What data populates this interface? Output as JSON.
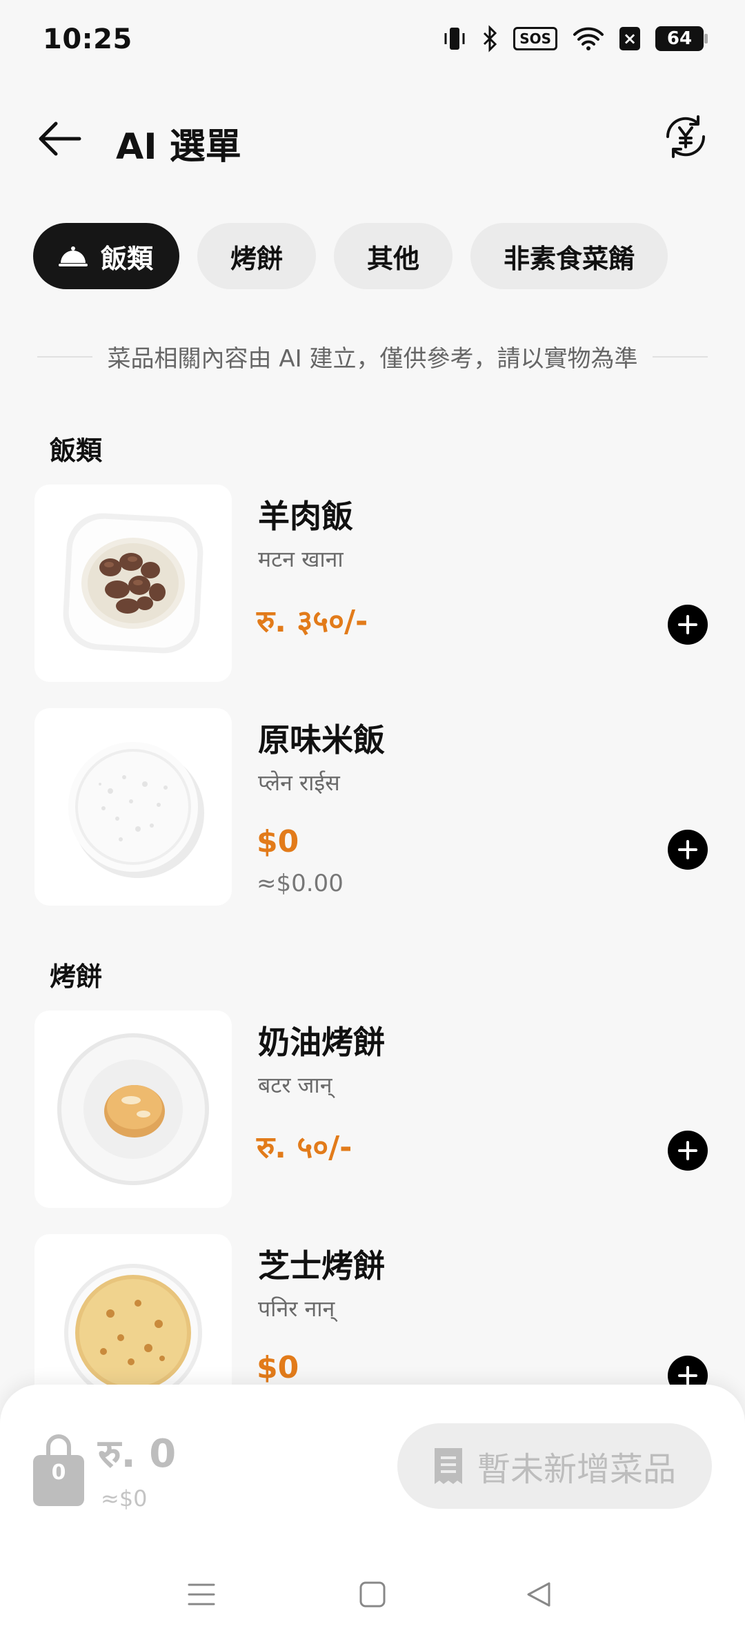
{
  "status": {
    "time": "10:25",
    "sos": "SOS",
    "x_badge": "×",
    "battery": "64"
  },
  "header": {
    "title": "AI 選單"
  },
  "tabs": [
    {
      "label": "飯類",
      "active": true
    },
    {
      "label": "烤餅"
    },
    {
      "label": "其他"
    },
    {
      "label": "非素食菜餚"
    }
  ],
  "disclaimer": "菜品相關內容由 AI 建立，僅供參考，請以實物為準",
  "sections": [
    {
      "title": "飯類",
      "items": [
        {
          "name": "羊肉飯",
          "sub": "मटन खाना",
          "price": "रु. ३५०/-"
        },
        {
          "name": "原味米飯",
          "sub": "प्लेन राईस",
          "price": "$0",
          "approx": "≈$0.00"
        }
      ]
    },
    {
      "title": "烤餅",
      "items": [
        {
          "name": "奶油烤餅",
          "sub": "बटर जान्",
          "price": "रु. ५०/-"
        },
        {
          "name": "芝士烤餅",
          "sub": "पनिर नान्",
          "price": "$0"
        }
      ]
    }
  ],
  "cart": {
    "count": "0",
    "total": "रु. 0",
    "approx": "≈$0",
    "button_label": "暫未新增菜品"
  },
  "colors": {
    "accent": "#e27b1a",
    "active_tab": "#161616",
    "background": "#f7f7f7"
  },
  "icons": [
    "back-arrow-icon",
    "currency-exchange-icon",
    "cloche-icon",
    "add-icon",
    "shopping-bag-icon",
    "receipt-icon",
    "menu-icon",
    "home-icon",
    "back-triangle-icon"
  ]
}
